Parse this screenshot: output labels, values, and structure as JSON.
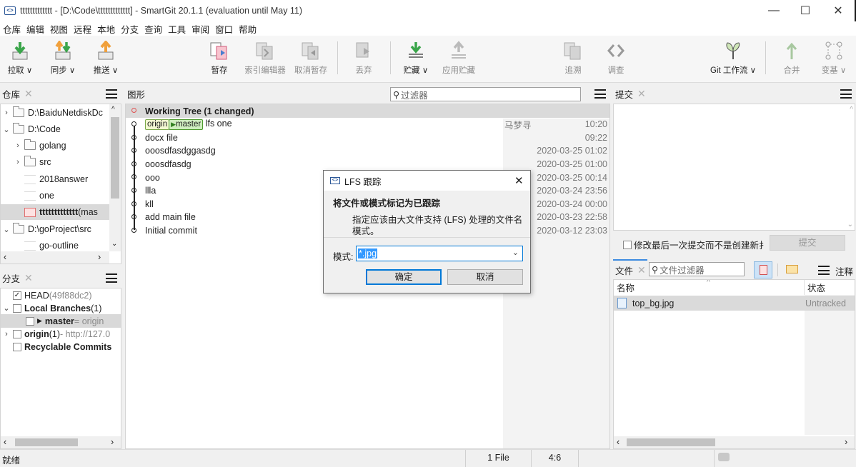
{
  "window": {
    "title": "ttttttttttttt - [D:\\Code\\ttttttttttttt] - SmartGit 20.1.1 (evaluation until May 11)",
    "minimize": "—",
    "maximize": "☐",
    "close": "✕"
  },
  "menu": [
    "仓库",
    "编辑",
    "视图",
    "远程",
    "本地",
    "分支",
    "查询",
    "工具",
    "审阅",
    "窗口",
    "帮助"
  ],
  "toolbar": {
    "pull": "拉取 ∨",
    "sync": "同步 ∨",
    "push": "推送 ∨",
    "stage": "暂存",
    "index_editor": "索引编辑器",
    "unstage": "取消暂存",
    "discard": "丢弃",
    "stash": "贮藏 ∨",
    "apply_stash": "应用贮藏",
    "log": "追溯",
    "investigate": "调查",
    "git_flow": "Git 工作流 ∨",
    "merge": "合并",
    "rebase": "变基 ∨"
  },
  "repositories": {
    "title": "仓库",
    "items": [
      {
        "label": "D:\\BaiduNetdiskDc"
      },
      {
        "label": "D:\\Code"
      },
      {
        "label": "golang"
      },
      {
        "label": "src"
      },
      {
        "label": "2018answer"
      },
      {
        "label": "one"
      },
      {
        "label": "ttttttttttttt",
        "suffix": " (mas"
      },
      {
        "label": "D:\\goProject\\src"
      },
      {
        "label": "go-outline"
      }
    ]
  },
  "branches": {
    "title": "分支",
    "head_label": "HEAD",
    "head_hash": " (49f88dc2)",
    "local_label": "Local Branches",
    "local_count": " (1)",
    "master_label": "master",
    "master_suffix": " = origin",
    "origin_label": "origin",
    "origin_count": " (1)",
    "origin_suffix": " - http://127.0",
    "recyclable": "Recyclable Commits"
  },
  "graph": {
    "title": "图形",
    "filter_placeholder": "过滤器",
    "working_tree": "Working Tree (1 changed)",
    "tag_origin": "origin",
    "tag_master": "master",
    "commits": [
      {
        "message": "lfs one",
        "author": "马梦寻",
        "date": "10:20"
      },
      {
        "message": "docx file",
        "author": "",
        "date": "09:22"
      },
      {
        "message": "ooosdfasdggasdg",
        "author": "",
        "date": "2020-03-25 01:02"
      },
      {
        "message": "ooosdfasdg",
        "author": "",
        "date": "2020-03-25 01:00"
      },
      {
        "message": "ooo",
        "author": "",
        "date": "2020-03-25 00:14"
      },
      {
        "message": "llla",
        "author": "",
        "date": "2020-03-24 23:56"
      },
      {
        "message": "kll",
        "author": "",
        "date": "2020-03-24 00:00"
      },
      {
        "message": "add main file",
        "author": "",
        "date": "2020-03-23 22:58"
      },
      {
        "message": "Initial commit",
        "author": "",
        "date": "2020-03-12 23:03"
      }
    ]
  },
  "commit_panel": {
    "title": "提交",
    "amend_label": "修改最后一次提交而不是创建新扌",
    "commit_button": "提交"
  },
  "files_panel": {
    "title": "文件",
    "filter_placeholder": "文件过滤器",
    "notes_label": "注释",
    "col_name": "名称",
    "col_status": "状态",
    "files": [
      {
        "name": "top_bg.jpg",
        "status": "Untracked"
      }
    ]
  },
  "dialog": {
    "title": "LFS 跟踪",
    "heading": "将文件或模式标记为已跟踪",
    "description_line1": "指定应该由大文件支持 (LFS) 处理的文件名",
    "description_line2": "模式。",
    "pattern_label": "模式:",
    "pattern_value": "*.jpg",
    "ok": "确定",
    "cancel": "取消"
  },
  "status_bar": {
    "message": "就绪",
    "files": "1 File",
    "position": "4:6"
  },
  "colors": {
    "accent": "#0078d7",
    "selected_text": "#3399ff",
    "toolbar_green": "#3aa54a",
    "toolbar_orange": "#f0a03c"
  }
}
